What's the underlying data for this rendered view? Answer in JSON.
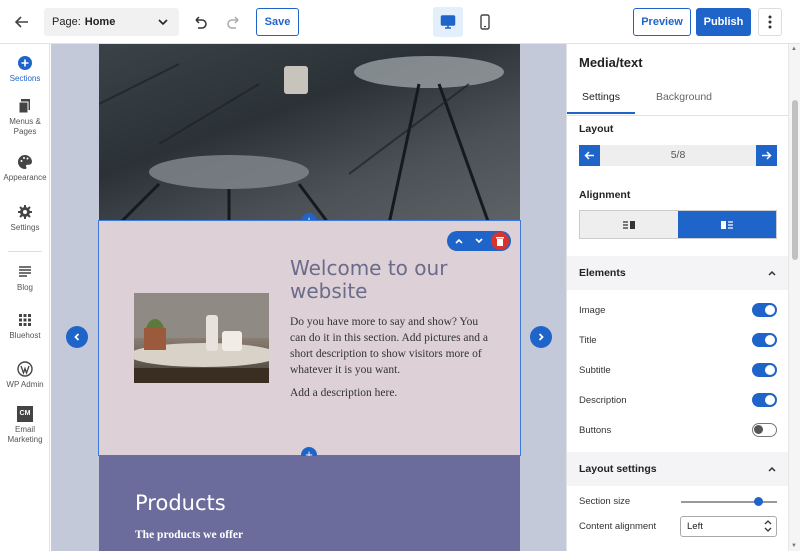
{
  "topbar": {
    "page_label": "Page:",
    "page_name": "Home",
    "save_label": "Save",
    "preview_label": "Preview",
    "publish_label": "Publish"
  },
  "leftnav": {
    "items": [
      {
        "label": "Sections",
        "icon": "plus-circle-icon"
      },
      {
        "label": "Menus &",
        "label2": "Pages",
        "icon": "pages-icon"
      },
      {
        "label": "Appearance",
        "icon": "palette-icon"
      },
      {
        "label": "Settings",
        "icon": "gear-icon"
      },
      {
        "label": "Blog",
        "icon": "blog-icon"
      },
      {
        "label": "Bluehost",
        "icon": "grid-icon"
      },
      {
        "label": "WP Admin",
        "icon": "wordpress-icon"
      },
      {
        "label": "Email",
        "label2": "Marketing",
        "icon": "cm-icon",
        "badge": "CM"
      }
    ]
  },
  "canvas": {
    "section_title": "Welcome to our website",
    "section_desc": "Do you have more to say and show? You can do it in this section. Add pictures and a short description to show visitors more of whatever it is you want.",
    "section_desc2": "Add a description here.",
    "products_title": "Products",
    "products_sub": "The products we offer"
  },
  "panel": {
    "title": "Media/text",
    "tabs": [
      "Settings",
      "Background"
    ],
    "layout_label": "Layout",
    "layout_value": "5/8",
    "alignment_label": "Alignment",
    "elements_label": "Elements",
    "toggles": [
      {
        "label": "Image",
        "on": true
      },
      {
        "label": "Title",
        "on": true
      },
      {
        "label": "Subtitle",
        "on": true
      },
      {
        "label": "Description",
        "on": true
      },
      {
        "label": "Buttons",
        "on": false
      }
    ],
    "layout_settings_label": "Layout settings",
    "section_size_label": "Section size",
    "section_size_value": 0.81,
    "content_alignment_label": "Content alignment",
    "content_alignment_value": "Left"
  },
  "colors": {
    "accent": "#1f64c9",
    "section_bg": "#ddd0d6",
    "products_bg": "#6c6c9c",
    "delete": "#d9342b"
  }
}
